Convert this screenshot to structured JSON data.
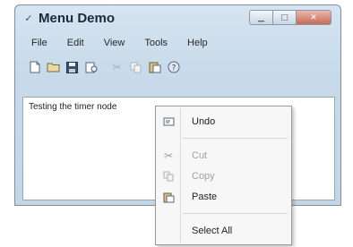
{
  "window": {
    "title": "Menu Demo",
    "icon": "checkmark-icon",
    "controls": [
      "minimize",
      "maximize",
      "close"
    ]
  },
  "menubar": {
    "items": [
      "File",
      "Edit",
      "View",
      "Tools",
      "Help"
    ]
  },
  "toolbar": {
    "buttons": [
      {
        "icon": "new-file-icon",
        "enabled": true
      },
      {
        "icon": "open-folder-icon",
        "enabled": true
      },
      {
        "icon": "save-icon",
        "enabled": true
      },
      {
        "icon": "print-preview-icon",
        "enabled": true
      },
      {
        "icon": "cut-icon",
        "enabled": false
      },
      {
        "icon": "copy-icon",
        "enabled": false
      },
      {
        "icon": "paste-icon",
        "enabled": true
      },
      {
        "icon": "help-icon",
        "enabled": true
      }
    ]
  },
  "editor": {
    "text": "Testing the timer node"
  },
  "context_menu": {
    "items": [
      {
        "label": "Undo",
        "icon": "undo-icon",
        "enabled": true
      },
      {
        "label": "Cut",
        "icon": "cut-icon",
        "enabled": false
      },
      {
        "label": "Copy",
        "icon": "copy-icon",
        "enabled": false
      },
      {
        "label": "Paste",
        "icon": "paste-icon",
        "enabled": true
      },
      {
        "label": "Select All",
        "icon": "",
        "enabled": true
      }
    ]
  }
}
